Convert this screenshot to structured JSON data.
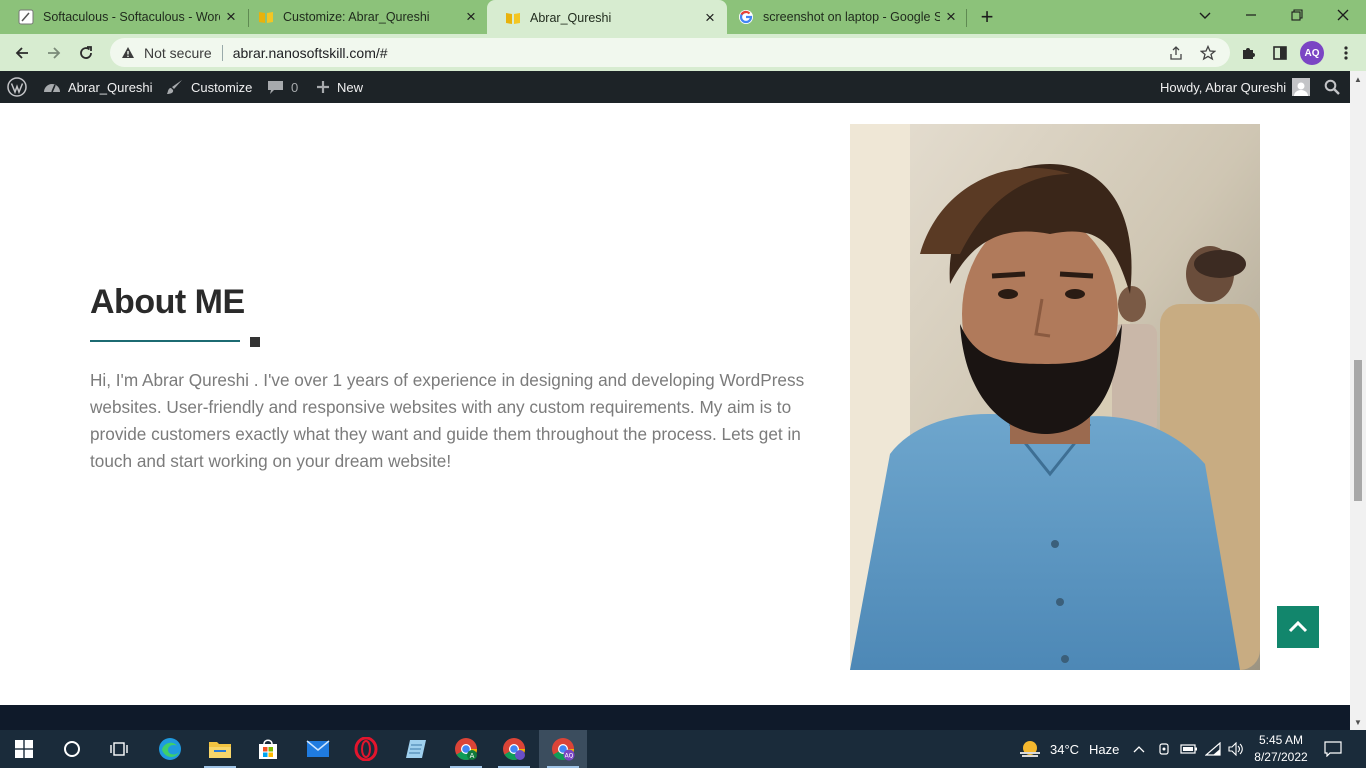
{
  "browser": {
    "tabs": [
      {
        "title": "Softaculous - Softaculous - WordPress",
        "active": false
      },
      {
        "title": "Customize: Abrar_Qureshi",
        "active": false
      },
      {
        "title": "Abrar_Qureshi",
        "active": true
      },
      {
        "title": "screenshot on laptop - Google Search",
        "active": false
      }
    ],
    "omnibox": {
      "security_label": "Not secure",
      "url": "abrar.nanosoftskill.com/#"
    },
    "profile_initials": "AQ",
    "colors": {
      "frame": "#8cc27a",
      "toolbar": "#d7ecd0",
      "profile": "#7b45c4"
    }
  },
  "admin_bar": {
    "site_name": "Abrar_Qureshi",
    "customize_label": "Customize",
    "comments_count": "0",
    "new_label": "New",
    "howdy": "Howdy, Abrar Qureshi"
  },
  "about": {
    "title": "About ME",
    "body": "Hi, I'm Abrar Qureshi . I've over 1 years of experience in designing and developing WordPress websites. User-friendly and responsive websites with any custom requirements. My aim is to provide customers exactly what they want and guide them throughout the process. Lets get in touch and start working on your dream website!",
    "accent_color": "#1c6b72",
    "scroll_top_color": "#12866c"
  },
  "taskbar": {
    "weather_temp": "34°C",
    "weather_desc": "Haze",
    "time": "5:45 AM",
    "date": "8/27/2022",
    "apps": [
      "start-icon",
      "search-icon",
      "task-view-icon",
      "edge-icon",
      "file-explorer-icon",
      "store-icon",
      "mail-icon",
      "opera-icon",
      "notepad-icon",
      "chrome-a-icon",
      "chrome-icon",
      "chrome-aq-icon"
    ]
  }
}
